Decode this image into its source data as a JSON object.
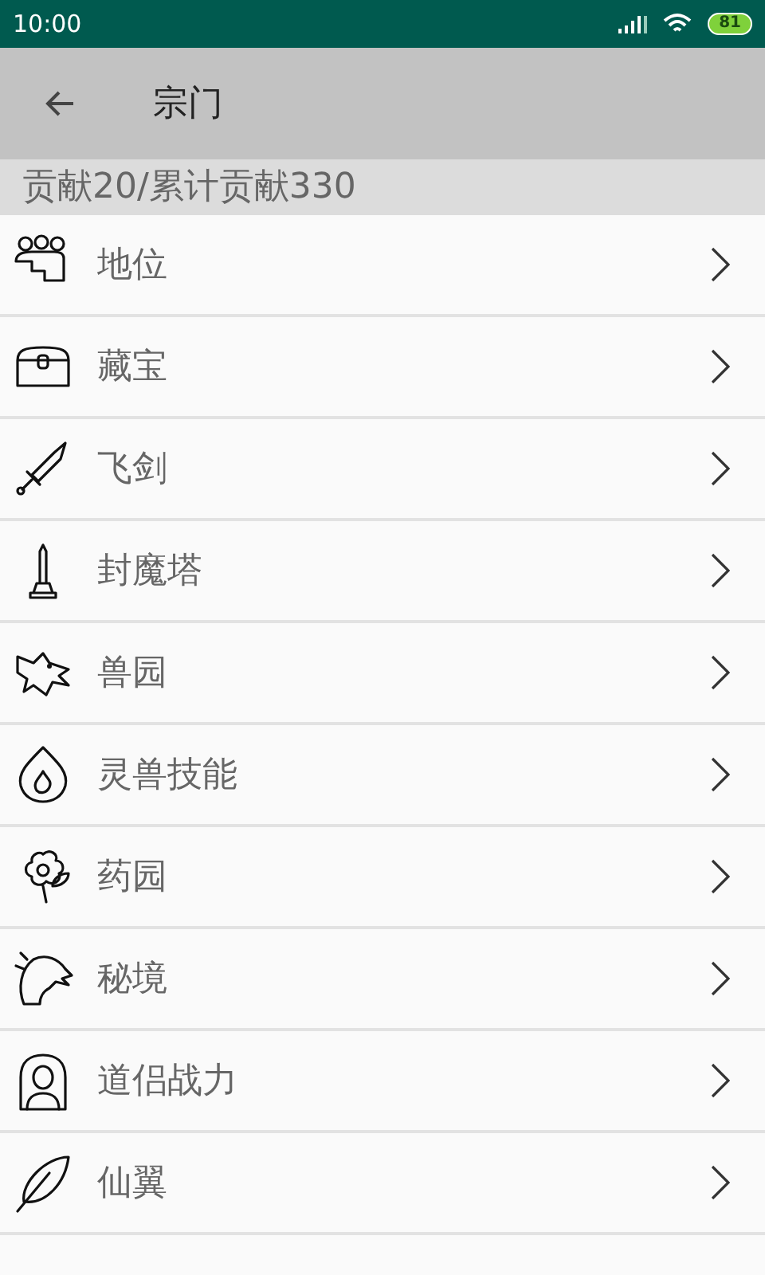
{
  "status_bar": {
    "time": "10:00",
    "battery": "81"
  },
  "toolbar": {
    "title": "宗门"
  },
  "summary": "贡献20/累计贡献330",
  "menu": [
    {
      "label": "地位"
    },
    {
      "label": "藏宝"
    },
    {
      "label": "飞剑"
    },
    {
      "label": "封魔塔"
    },
    {
      "label": "兽园"
    },
    {
      "label": "灵兽技能"
    },
    {
      "label": "药园"
    },
    {
      "label": "秘境"
    },
    {
      "label": "道侣战力"
    },
    {
      "label": "仙翼"
    }
  ]
}
